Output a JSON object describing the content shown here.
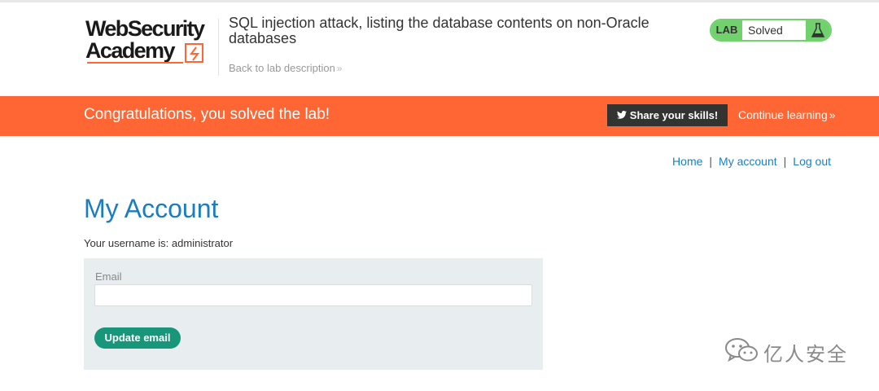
{
  "logo": {
    "line1": "WebSecurity",
    "line2": "Academy"
  },
  "lab": {
    "title": "SQL injection attack, listing the database contents on non-Oracle databases",
    "back_link": "Back to lab description",
    "badge_label": "LAB",
    "status": "Solved"
  },
  "banner": {
    "message": "Congratulations, you solved the lab!",
    "share_label": "Share your skills!",
    "continue_label": "Continue learning"
  },
  "nav": {
    "home": "Home",
    "my_account": "My account",
    "log_out": "Log out",
    "separator": "|"
  },
  "page": {
    "title": "My Account",
    "username_line": "Your username is: administrator"
  },
  "form": {
    "email_label": "Email",
    "email_value": "",
    "update_button": "Update email"
  },
  "watermark": {
    "text": "亿人安全"
  },
  "colors": {
    "accent_orange": "#ff6633",
    "lab_green": "#70d16d",
    "link_blue": "#1a7fc4",
    "button_teal": "#17967a",
    "form_bg": "#e8eef0"
  }
}
